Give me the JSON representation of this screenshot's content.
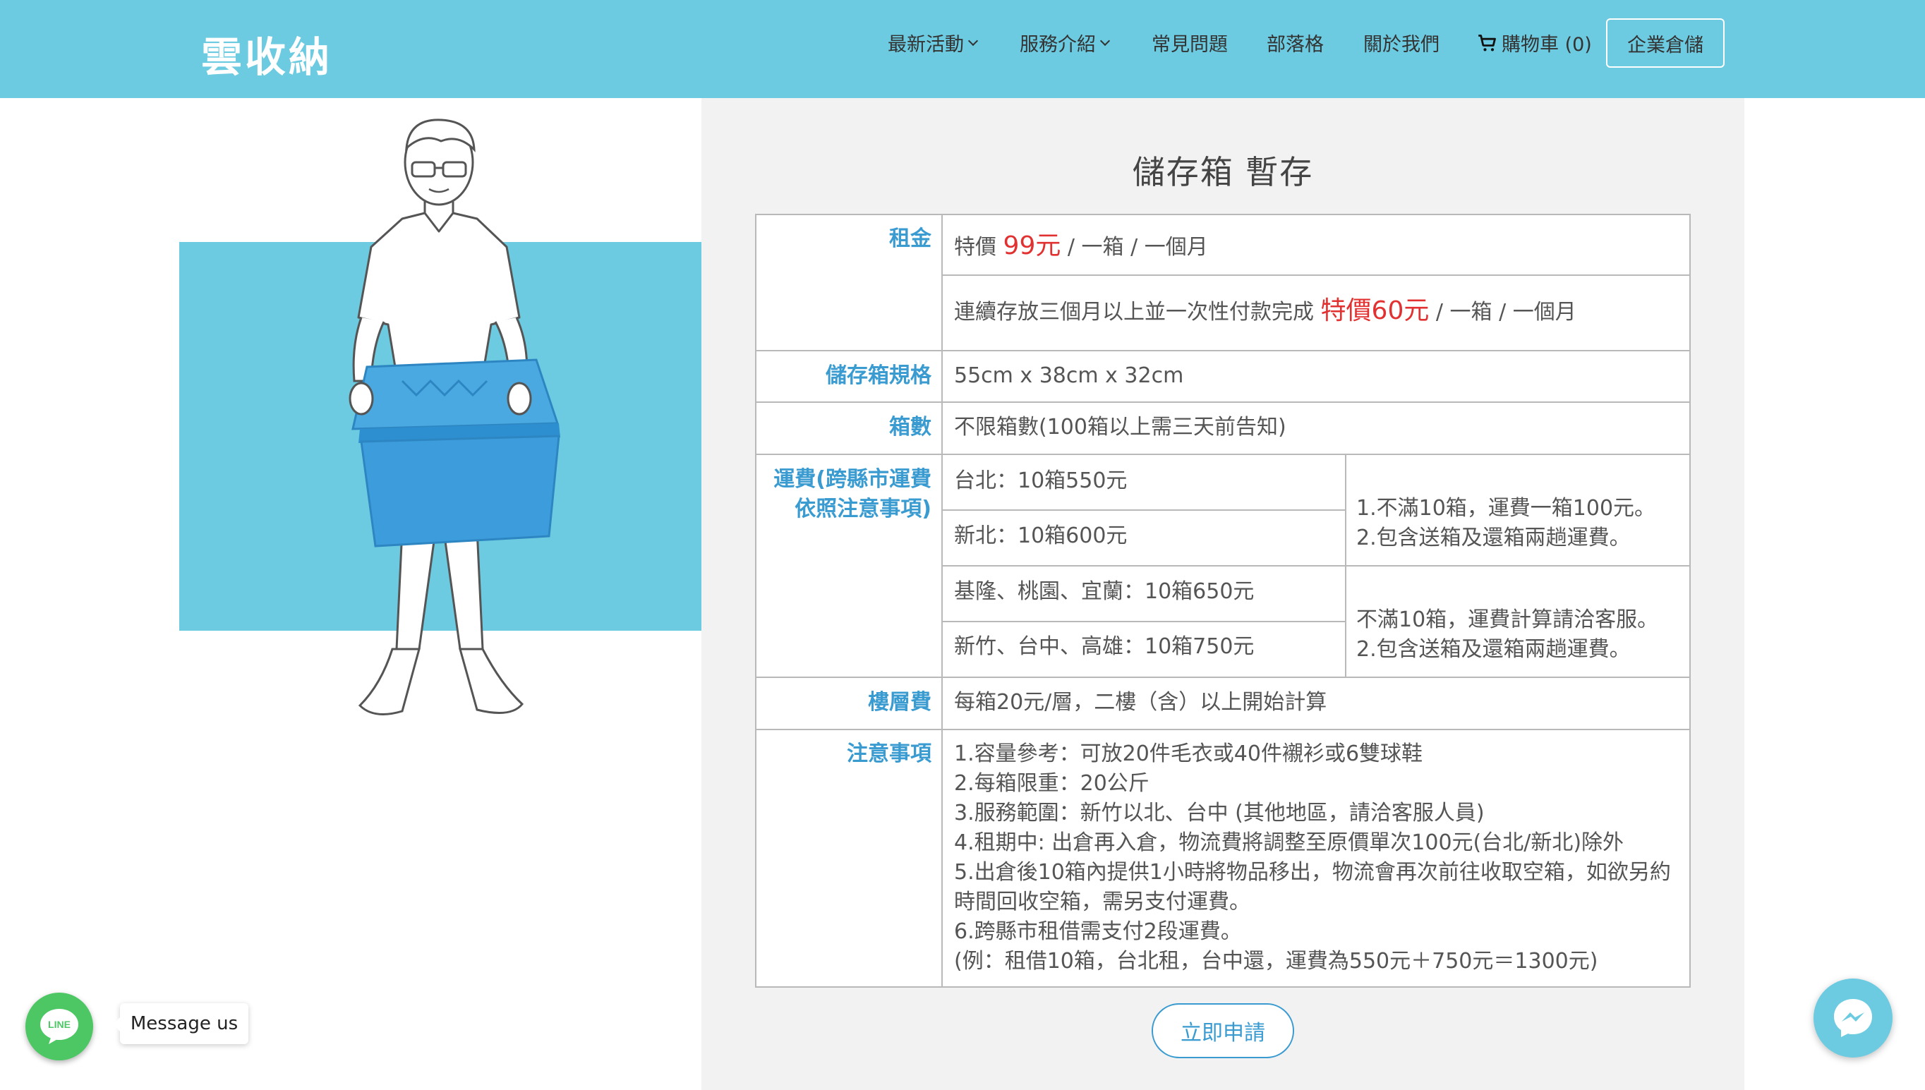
{
  "header": {
    "logo": "雲收納",
    "nav": {
      "activities": "最新活動",
      "services": "服務介紹",
      "faq": "常見問題",
      "blog": "部落格",
      "about": "關於我們",
      "cart": "購物車 (0)",
      "enterprise": "企業倉儲"
    }
  },
  "page": {
    "title": "儲存箱 暫存",
    "apply_button": "立即申請"
  },
  "table": {
    "rent": {
      "label": "租金",
      "row1": {
        "prefix": "特價 ",
        "price": "99元",
        "suffix": " / 一箱 / 一個月"
      },
      "row2": {
        "prefix": "連續存放三個月以上並一次性付款完成 ",
        "price": "特價60元",
        "suffix": " / 一箱 / 一個月"
      }
    },
    "spec": {
      "label": "儲存箱規格",
      "value": "55cm x 38cm x 32cm"
    },
    "count": {
      "label": "箱數",
      "value": "不限箱數(100箱以上需三天前告知)"
    },
    "shipping": {
      "label_line1": "運費(跨縣市運費",
      "label_line2": "依照注意事項)",
      "taipei": "台北：10箱550元",
      "newtaipei": "新北：10箱600元",
      "note_a_line1": "1.不滿10箱，運費一箱100元。",
      "note_a_line2": "2.包含送箱及還箱兩趟運費。",
      "keelung": "基隆、桃園、宜蘭：10箱650元",
      "hsinchu": "新竹、台中、高雄：10箱750元",
      "note_b_line1": "不滿10箱，運費計算請洽客服。",
      "note_b_line2": "2.包含送箱及還箱兩趟運費。"
    },
    "floor": {
      "label": "樓層費",
      "value": "每箱20元/層，二樓（含）以上開始計算"
    },
    "notes": {
      "label": "注意事項",
      "lines": [
        "1.容量參考：可放20件毛衣或40件襯衫或6雙球鞋",
        "2.每箱限重：20公斤",
        "3.服務範圍：新竹以北、台中 (其他地區，請洽客服人員)",
        "4.租期中: 出倉再入倉，物流費將調整至原價單次100元(台北/新北)除外",
        "5.出倉後10箱內提供1小時將物品移出，物流會再次前往收取空箱，如欲另約",
        "時間回收空箱，需另支付運費。",
        "6.跨縣市租借需支付2段運費。",
        "(例：租借10箱，台北租，台中還，運費為550元＋750元＝1300元)"
      ]
    }
  },
  "widgets": {
    "line_text": "LINE",
    "message_us": "Message us"
  },
  "colors": {
    "header_bg": "#6ccbe1",
    "accent_blue": "#3a9bd1",
    "price_red": "#e23131",
    "line_green": "#4cc764"
  }
}
